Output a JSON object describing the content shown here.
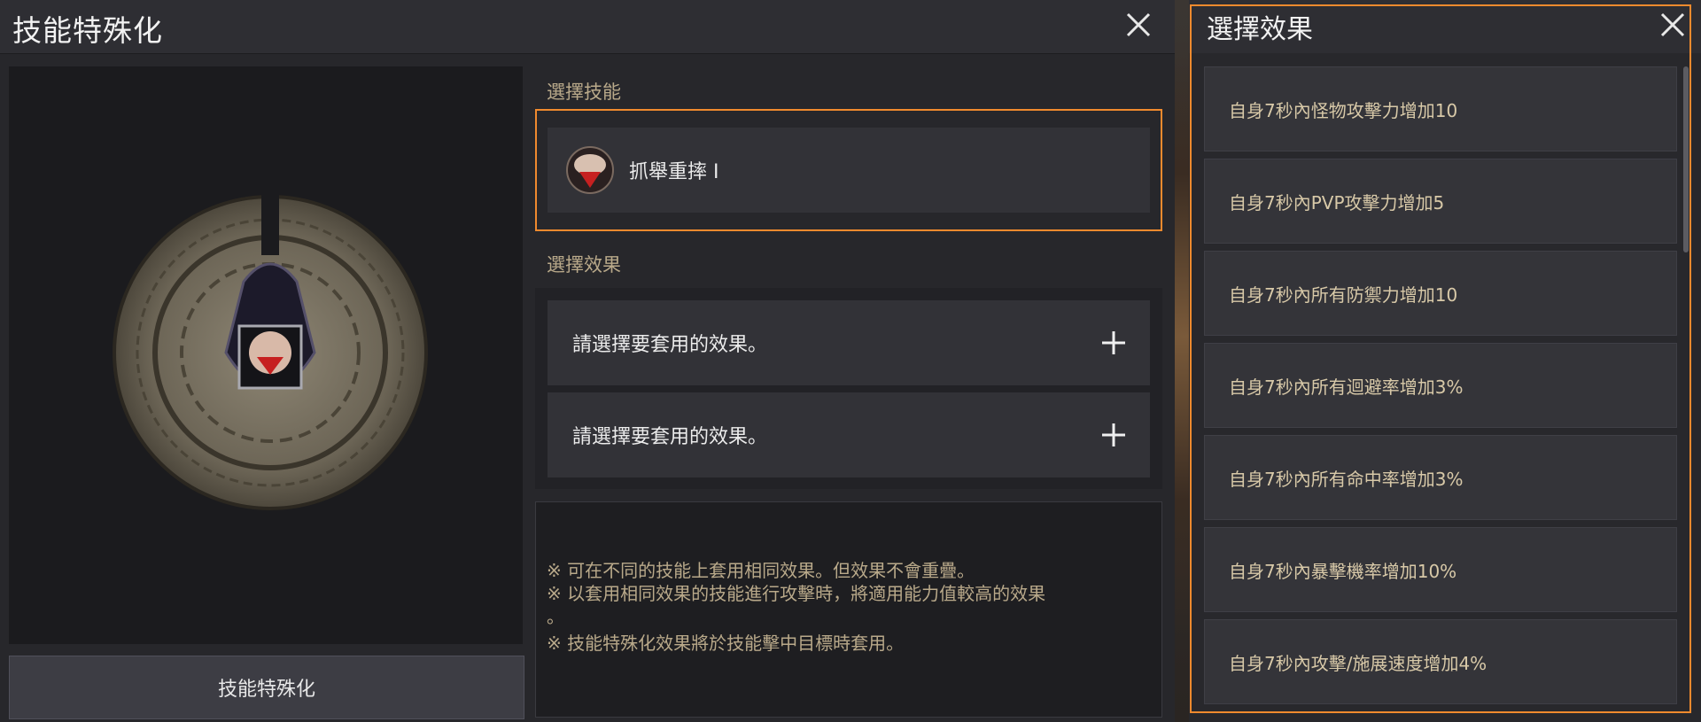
{
  "left_panel": {
    "title": "技能特殊化",
    "close_icon": "close-icon",
    "select_skill_label": "選擇技能",
    "skill": {
      "name": "抓舉重摔 Ⅰ",
      "icon": "fist-skill-icon"
    },
    "select_effect_label": "選擇效果",
    "effect_slots": [
      {
        "text": "請選擇要套用的效果。",
        "icon": "plus-icon"
      },
      {
        "text": "請選擇要套用的效果。",
        "icon": "plus-icon"
      }
    ],
    "notes": [
      "※ 可在不同的技能上套用相同效果。但效果不會重疊。",
      "※ 以套用相同效果的技能進行攻擊時，將適用能力值較高的效果",
      "。",
      "※ 技能特殊化效果將於技能擊中目標時套用。"
    ],
    "specialize_button": "技能特殊化"
  },
  "right_panel": {
    "title": "選擇效果",
    "close_icon": "close-icon",
    "options": [
      "自身7秒內怪物攻擊力增加10",
      "自身7秒內PVP攻擊力增加5",
      "自身7秒內所有防禦力增加10",
      "自身7秒內所有迴避率增加3%",
      "自身7秒內所有命中率增加3%",
      "自身7秒內暴擊機率增加10%",
      "自身7秒內攻擊/施展速度增加4%"
    ]
  },
  "colors": {
    "highlight": "#f08a2e",
    "label_gold": "#b9a98a",
    "option_text": "#d8c9a8"
  }
}
